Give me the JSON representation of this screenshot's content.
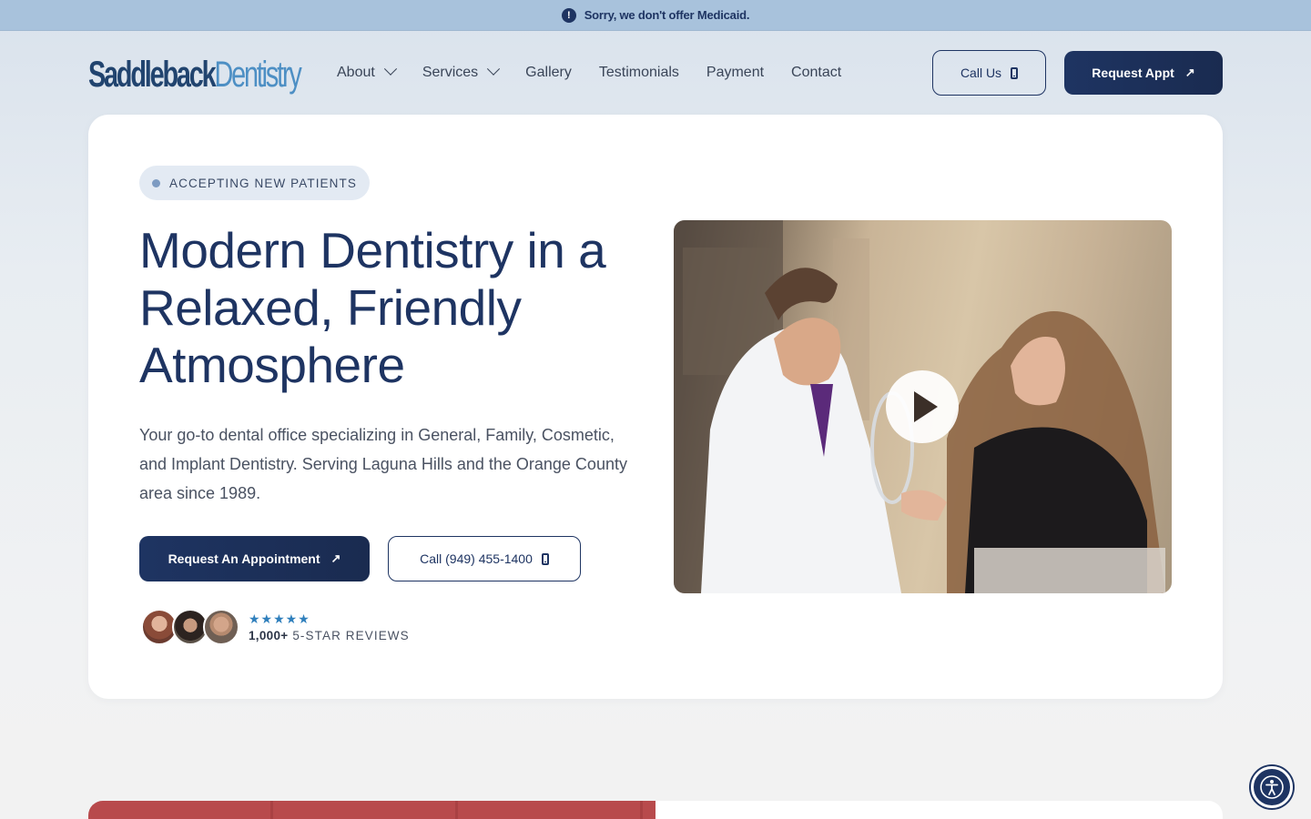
{
  "notice": {
    "icon": "info-icon",
    "text": "Sorry, we don't offer Medicaid."
  },
  "logo": {
    "part1": "Saddleback",
    "part2": "Dentistry"
  },
  "nav": [
    {
      "label": "About",
      "has_dropdown": true
    },
    {
      "label": "Services",
      "has_dropdown": true
    },
    {
      "label": "Gallery",
      "has_dropdown": false
    },
    {
      "label": "Testimonials",
      "has_dropdown": false
    },
    {
      "label": "Payment",
      "has_dropdown": false
    },
    {
      "label": "Contact",
      "has_dropdown": false
    }
  ],
  "header_actions": {
    "call_label": "Call Us",
    "request_label": "Request Appt"
  },
  "hero": {
    "badge": "ACCEPTING NEW PATIENTS",
    "title": "Modern Dentistry in a Relaxed, Friendly Atmosphere",
    "description": "Your go-to dental office specializing in General, Family, Cosmetic, and Implant Dentistry. Serving Laguna Hills and the Orange County area since 1989.",
    "primary_button": "Request An Appointment",
    "call_button": "Call (949) 455-1400",
    "stars": "★★★★★",
    "review_count": "1,000+",
    "review_label": "5-STAR REVIEWS"
  },
  "video": {
    "play_icon": "play-icon"
  },
  "colors": {
    "navy": "#1e3462",
    "notice_bg": "#a8c2dc",
    "accent_blue": "#4d8fc4",
    "star": "#2f7fbc"
  }
}
